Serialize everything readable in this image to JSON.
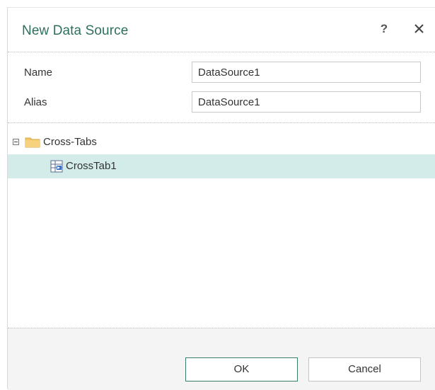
{
  "dialog": {
    "title": "New Data Source",
    "help_label": "?",
    "title_color": "#2e6f5e"
  },
  "properties": {
    "name": {
      "label": "Name",
      "value": "DataSource1"
    },
    "alias": {
      "label": "Alias",
      "value": "DataSource1"
    }
  },
  "tree": {
    "folder": {
      "label": "Cross-Tabs",
      "icon": "folder-icon",
      "expanded": true
    },
    "items": [
      {
        "label": "CrossTab1",
        "icon": "crosstab-icon",
        "selected": true
      }
    ],
    "selection_color": "#d3ece9"
  },
  "buttons": {
    "ok": "OK",
    "cancel": "Cancel"
  }
}
